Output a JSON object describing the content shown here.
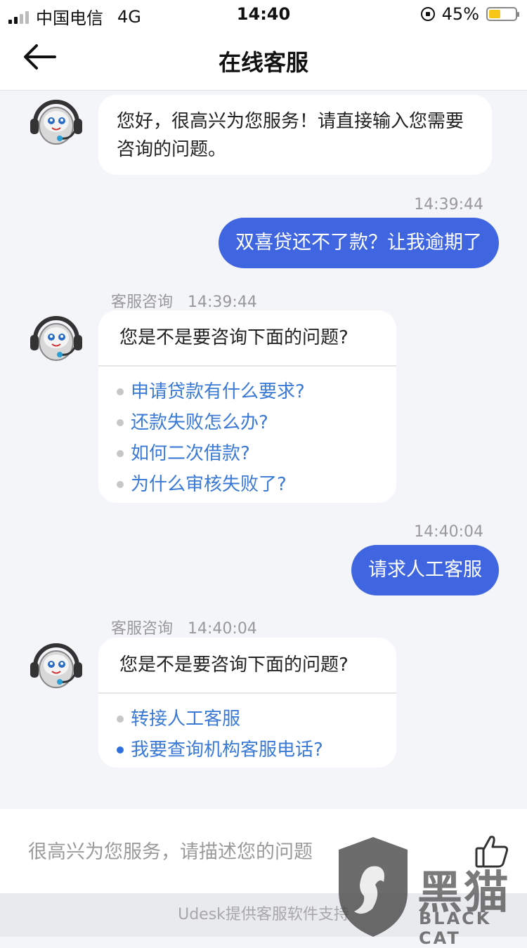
{
  "status": {
    "carrier": "中国电信",
    "network": "4G",
    "time": "14:40",
    "battery": "45%",
    "battery_level": 0.45
  },
  "nav": {
    "title": "在线客服"
  },
  "messages": {
    "greeting": {
      "text": "您好，很高兴为您服务！请直接输入您需要咨询的问题。"
    },
    "user1": {
      "time": "14:39:44",
      "text": "双喜贷还不了款？让我逾期了"
    },
    "agent1": {
      "sender": "客服咨询",
      "time": "14:39:44",
      "question": "您是不是要咨询下面的问题?",
      "options": [
        "申请贷款有什么要求?",
        "还款失败怎么办?",
        "如何二次借款?",
        "为什么审核失败了?"
      ]
    },
    "user2": {
      "time": "14:40:04",
      "text": "请求人工客服"
    },
    "agent2": {
      "sender": "客服咨询",
      "time": "14:40:04",
      "question": "您是不是要咨询下面的问题?",
      "options": [
        "转接人工客服",
        "我要查询机构客服电话?"
      ]
    }
  },
  "input": {
    "placeholder": "很高兴为您服务，请描述您的问题"
  },
  "footer": {
    "text": "Udesk提供客服软件支持"
  },
  "watermark": {
    "cn": "黑猫",
    "en": "BLACK CAT"
  }
}
